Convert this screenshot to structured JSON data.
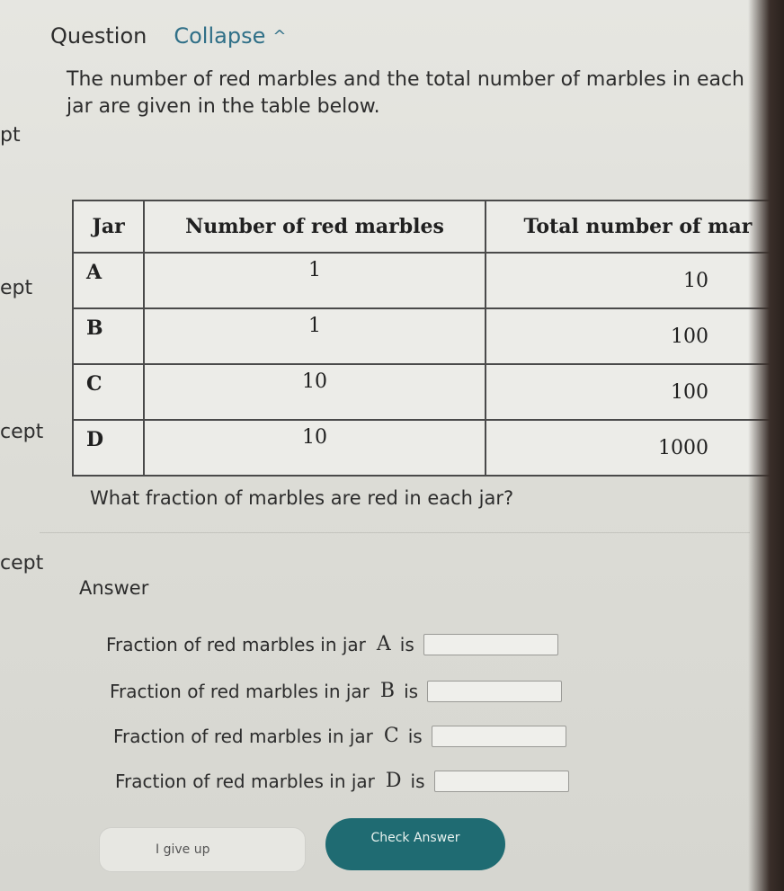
{
  "sidebar_fragments": [
    "pt",
    "ept",
    "cept",
    "cept"
  ],
  "header": {
    "question_label": "Question",
    "collapse_label": "Collapse",
    "collapse_icon": "^"
  },
  "prompt": "The number of red marbles and the total number of marbles in each jar are given in the table below.",
  "table": {
    "headers": [
      "Jar",
      "Number of red marbles",
      "Total number of mar"
    ],
    "rows": [
      {
        "jar": "A",
        "red": "1",
        "total": "10"
      },
      {
        "jar": "B",
        "red": "1",
        "total": "100"
      },
      {
        "jar": "C",
        "red": "10",
        "total": "100"
      },
      {
        "jar": "D",
        "red": "10",
        "total": "1000"
      }
    ]
  },
  "question": "What fraction of marbles are red in each jar?",
  "answer_label": "Answer",
  "answers": [
    {
      "prefix": "Fraction of red marbles in jar",
      "jar": "A",
      "suffix": "is",
      "value": ""
    },
    {
      "prefix": "Fraction of red marbles in jar",
      "jar": "B",
      "suffix": "is",
      "value": ""
    },
    {
      "prefix": "Fraction of red marbles in jar",
      "jar": "C",
      "suffix": "is",
      "value": ""
    },
    {
      "prefix": "Fraction of red marbles in jar",
      "jar": "D",
      "suffix": "is",
      "value": ""
    }
  ],
  "buttons": {
    "give_up": "I give up",
    "check": "Check Answer"
  }
}
